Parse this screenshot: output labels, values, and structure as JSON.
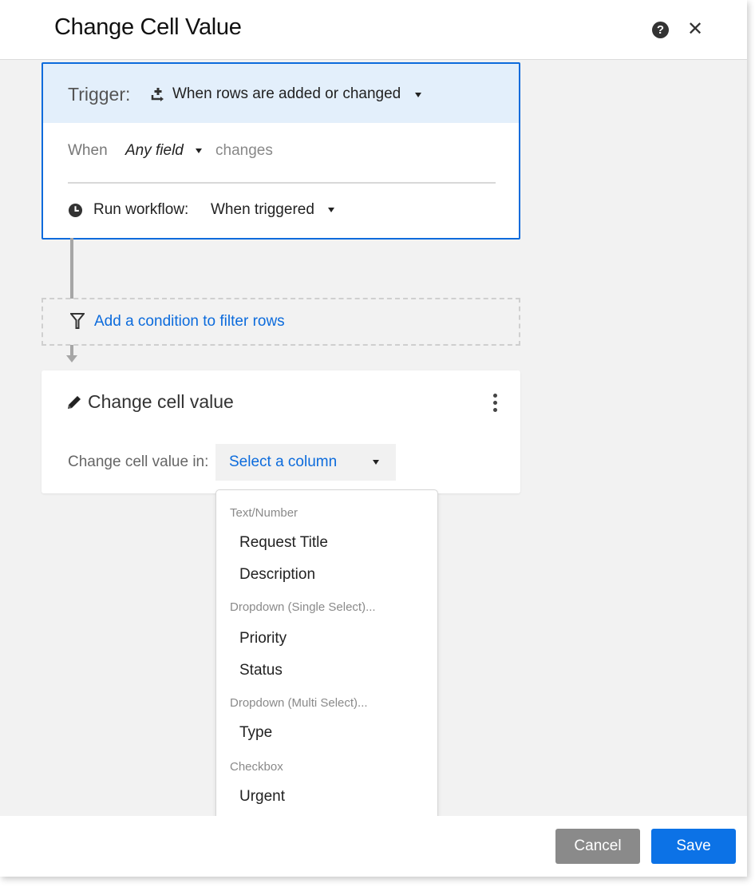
{
  "dialog": {
    "title": "Change Cell Value",
    "help_icon": "help-circle-icon",
    "close_icon": "close-icon"
  },
  "trigger": {
    "label": "Trigger:",
    "icon": "rows-add-change-icon",
    "value": "When rows are added or changed",
    "when_label": "When",
    "field_value": "Any field",
    "changes_label": "changes",
    "run_icon": "clock-icon",
    "run_label": "Run workflow:",
    "run_value": "When triggered"
  },
  "condition": {
    "icon": "filter-icon",
    "link_text": "Add a condition to filter rows"
  },
  "action": {
    "icon": "pencil-icon",
    "title": "Change cell value",
    "menu_icon": "kebab-menu-icon",
    "field_label": "Change cell value in:",
    "select_placeholder": "Select a column"
  },
  "dropdown": {
    "groups": [
      {
        "label": "Text/Number",
        "items": [
          "Request Title",
          "Description"
        ]
      },
      {
        "label": "Dropdown (Single Select)...",
        "items": [
          "Priority",
          "Status"
        ]
      },
      {
        "label": "Dropdown (Multi Select)...",
        "items": [
          "Type"
        ]
      },
      {
        "label": "Checkbox",
        "items": [
          "Urgent"
        ]
      }
    ]
  },
  "footer": {
    "cancel_label": "Cancel",
    "save_label": "Save"
  },
  "colors": {
    "accent": "#0c6bdc",
    "save_button": "#0c72e6",
    "cancel_button": "#8a8a8a",
    "trigger_header_bg": "#e3effb"
  }
}
